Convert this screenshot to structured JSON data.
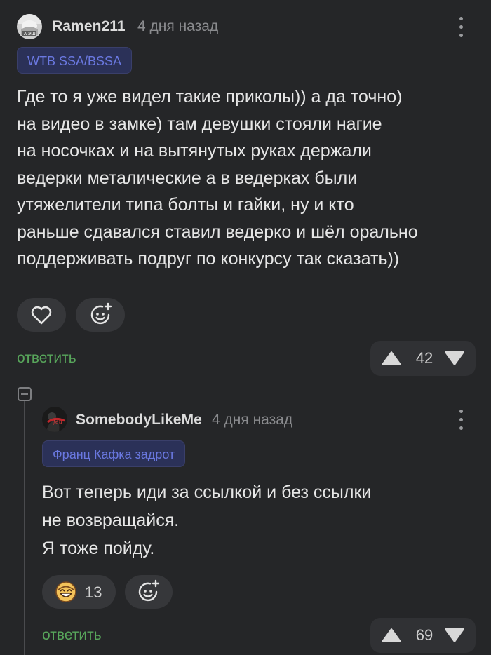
{
  "comment1": {
    "username": "Ramen211",
    "time": "4 дня назад",
    "badge": "WTB SSA/BSSA",
    "avatar_icon": "avatar-ramen211",
    "lines": [
      "Где то я уже видел такие приколы)) а да точно)",
      "на видео в замке) там девушки стояли нагие",
      "на носочках и на вытянутых руках держали",
      "ведерки металические а в ведерках были",
      "утяжелители типа болты и гайки, ну и кто",
      "раньше сдавался ставил ведерко и шёл орально",
      "поддерживать подруг по конкурсу так сказать))"
    ],
    "reply_label": "ответить",
    "score": "42"
  },
  "comment2": {
    "username": "SomebodyLikeMe",
    "time": "4 дня назад",
    "badge": "Франц Кафка задрот",
    "avatar_icon": "avatar-somebodylikeme",
    "lines": [
      "Вот теперь иди за ссылкой и без ссылки",
      "не возвращайся.",
      "Я тоже пойду."
    ],
    "reaction_count": "13",
    "reply_label": "ответить",
    "score": "69"
  },
  "colors": {
    "background": "#252628",
    "reply_link": "#58a65b",
    "badge_text": "#6a78e0",
    "badge_bg": "#2b3158",
    "pill_bg": "#36373a"
  },
  "icons": [
    "heart-icon",
    "add-reaction-icon",
    "smile-emoji-icon",
    "upvote-icon",
    "downvote-icon",
    "more-menu-icon",
    "collapse-icon"
  ]
}
